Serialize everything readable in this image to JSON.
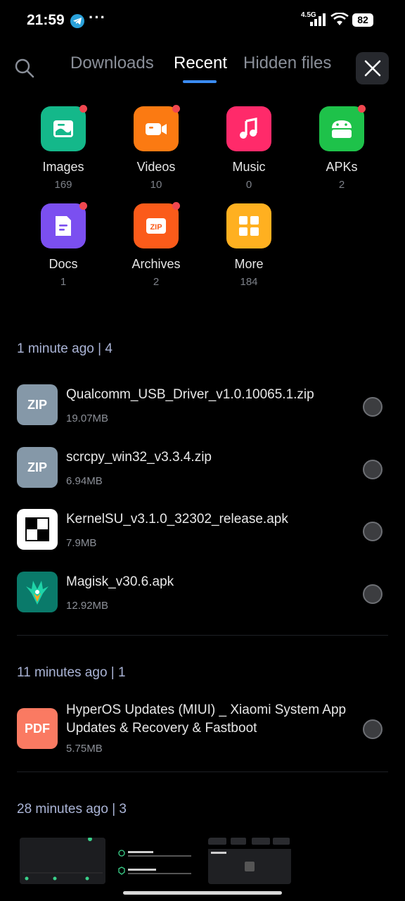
{
  "status_bar": {
    "time": "21:59",
    "notification_dots": "···",
    "network": "4.5G",
    "battery": "82",
    "icons": [
      "telegram-icon",
      "signal-icon",
      "wifi-icon",
      "battery-icon"
    ]
  },
  "header": {
    "tabs": [
      {
        "label": "Downloads",
        "active": false
      },
      {
        "label": "Recent",
        "active": true
      },
      {
        "label": "Hidden files",
        "active": false
      }
    ],
    "accent_color": "#3b8cf5"
  },
  "categories": [
    {
      "label": "Images",
      "count": "169",
      "color": "#14b88a",
      "icon": "image-icon",
      "new": true
    },
    {
      "label": "Videos",
      "count": "10",
      "color": "#fb7a12",
      "icon": "video-icon",
      "new": true
    },
    {
      "label": "Music",
      "count": "0",
      "color": "#ff2a6a",
      "icon": "music-icon",
      "new": false
    },
    {
      "label": "APKs",
      "count": "2",
      "color": "#1ec24a",
      "icon": "android-icon",
      "new": true
    },
    {
      "label": "Docs",
      "count": "1",
      "color": "#7b4ff0",
      "icon": "document-icon",
      "new": true
    },
    {
      "label": "Archives",
      "count": "2",
      "color": "#fb5b1a",
      "icon": "zip-icon",
      "new": true
    },
    {
      "label": "More",
      "count": "184",
      "color": "#ffb020",
      "icon": "grid-icon",
      "new": false
    }
  ],
  "sections": [
    {
      "heading": "1 minute ago | 4",
      "files": [
        {
          "name": "Qualcomm_USB_Driver_v1.0.10065.1.zip",
          "size": "19.07MB",
          "thumb": "ZIP",
          "thumb_color": "#8598a8"
        },
        {
          "name": "scrcpy_win32_v3.3.4.zip",
          "size": "6.94MB",
          "thumb": "ZIP",
          "thumb_color": "#8598a8"
        },
        {
          "name": "KernelSU_v3.1.0_32302_release.apk",
          "size": "7.9MB",
          "thumb": "",
          "thumb_color": "#ffffff"
        },
        {
          "name": "Magisk_v30.6.apk",
          "size": "12.92MB",
          "thumb": "",
          "thumb_color": "#0a7a6a"
        }
      ]
    },
    {
      "heading": "11 minutes ago | 1",
      "files": [
        {
          "name": "HyperOS Updates (MIUI) _ Xiaomi System App Updates & Recovery & Fastboot",
          "size": "5.75MB",
          "thumb": "PDF",
          "thumb_color": "#fa7a62"
        }
      ]
    },
    {
      "heading": "28 minutes ago | 3",
      "files": []
    }
  ],
  "thumbnail_previews": {
    "tile1": {
      "labels": [
        "Block calls",
        "Privacy protection",
        "Whitelist"
      ]
    },
    "tile2": {
      "title1": "Block ads",
      "title2": "Privacy protection"
    },
    "tile3": {
      "title": "Recent"
    }
  }
}
